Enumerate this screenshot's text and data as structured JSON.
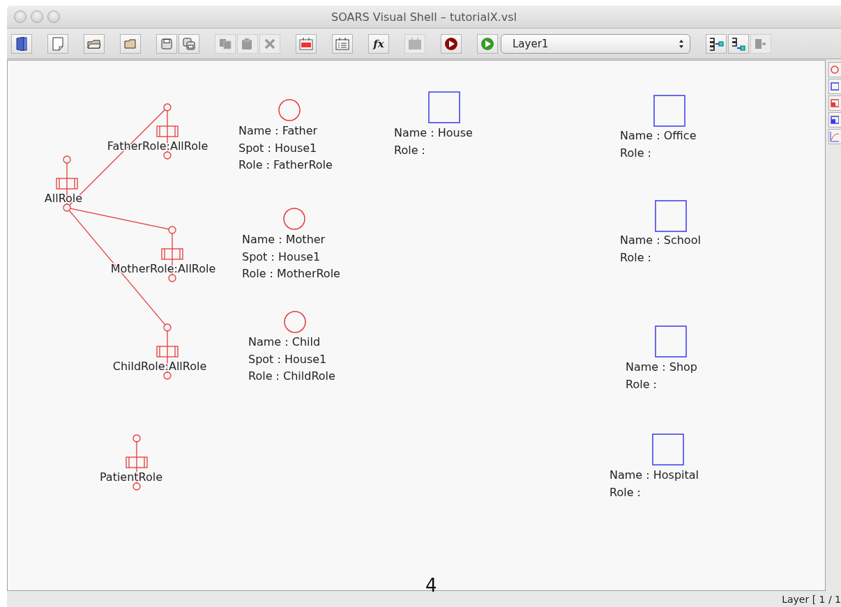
{
  "window": {
    "title": "SOARS Visual Shell – tutorialX.vsl"
  },
  "toolbar": {
    "groups": [
      [
        {
          "kind": "exit",
          "disabled": false
        }
      ],
      [
        {
          "kind": "new",
          "disabled": false
        }
      ],
      [
        {
          "kind": "open",
          "disabled": false
        }
      ],
      [
        {
          "kind": "folder",
          "disabled": false
        }
      ],
      [
        {
          "kind": "save",
          "disabled": false
        },
        {
          "kind": "save-as",
          "disabled": false
        }
      ],
      [
        {
          "kind": "copy",
          "disabled": true
        },
        {
          "kind": "paste",
          "disabled": true
        },
        {
          "kind": "delete",
          "disabled": true
        }
      ],
      [
        {
          "kind": "agent-rule",
          "disabled": false
        }
      ],
      [
        {
          "kind": "spot-rule",
          "disabled": false
        }
      ],
      [
        {
          "kind": "function",
          "label": "fx",
          "disabled": false
        }
      ],
      [
        {
          "kind": "chart",
          "disabled": true
        }
      ],
      [
        {
          "kind": "stop",
          "disabled": false
        }
      ],
      [
        {
          "kind": "run",
          "disabled": false
        }
      ]
    ],
    "layer_select": {
      "value": "Layer1"
    },
    "layer_groups": [
      [
        {
          "kind": "add-layer",
          "disabled": false
        },
        {
          "kind": "insert-layer",
          "disabled": false
        },
        {
          "kind": "remove-layer",
          "disabled": true
        }
      ]
    ]
  },
  "canvas": {
    "roles": [
      {
        "name": "FatherRole:AllRole"
      },
      {
        "name": "AllRole"
      },
      {
        "name": "MotherRole:AllRole"
      },
      {
        "name": "ChildRole:AllRole"
      },
      {
        "name": "PatientRole"
      }
    ],
    "agents": [
      {
        "lines": [
          "Name : Father",
          "Spot : House1",
          "Role : FatherRole"
        ]
      },
      {
        "lines": [
          "Name : Mother",
          "Spot : House1",
          "Role : MotherRole"
        ]
      },
      {
        "lines": [
          "Name : Child",
          "Spot : House1",
          "Role : ChildRole"
        ]
      }
    ],
    "spots": [
      {
        "lines": [
          "Name : House",
          "Role :"
        ]
      },
      {
        "lines": [
          "Name : Office",
          "Role :"
        ]
      },
      {
        "lines": [
          "Name : School",
          "Role :"
        ]
      },
      {
        "lines": [
          "Name : Shop",
          "Role :"
        ]
      },
      {
        "lines": [
          "Name : Hospital",
          "Role :"
        ]
      }
    ]
  },
  "palette": [
    {
      "kind": "agent"
    },
    {
      "kind": "spot"
    },
    {
      "kind": "agent-role"
    },
    {
      "kind": "spot-role"
    },
    {
      "kind": "chart"
    }
  ],
  "page_number": "4",
  "status_bar": {
    "text": "Layer [ 1 / 1"
  }
}
